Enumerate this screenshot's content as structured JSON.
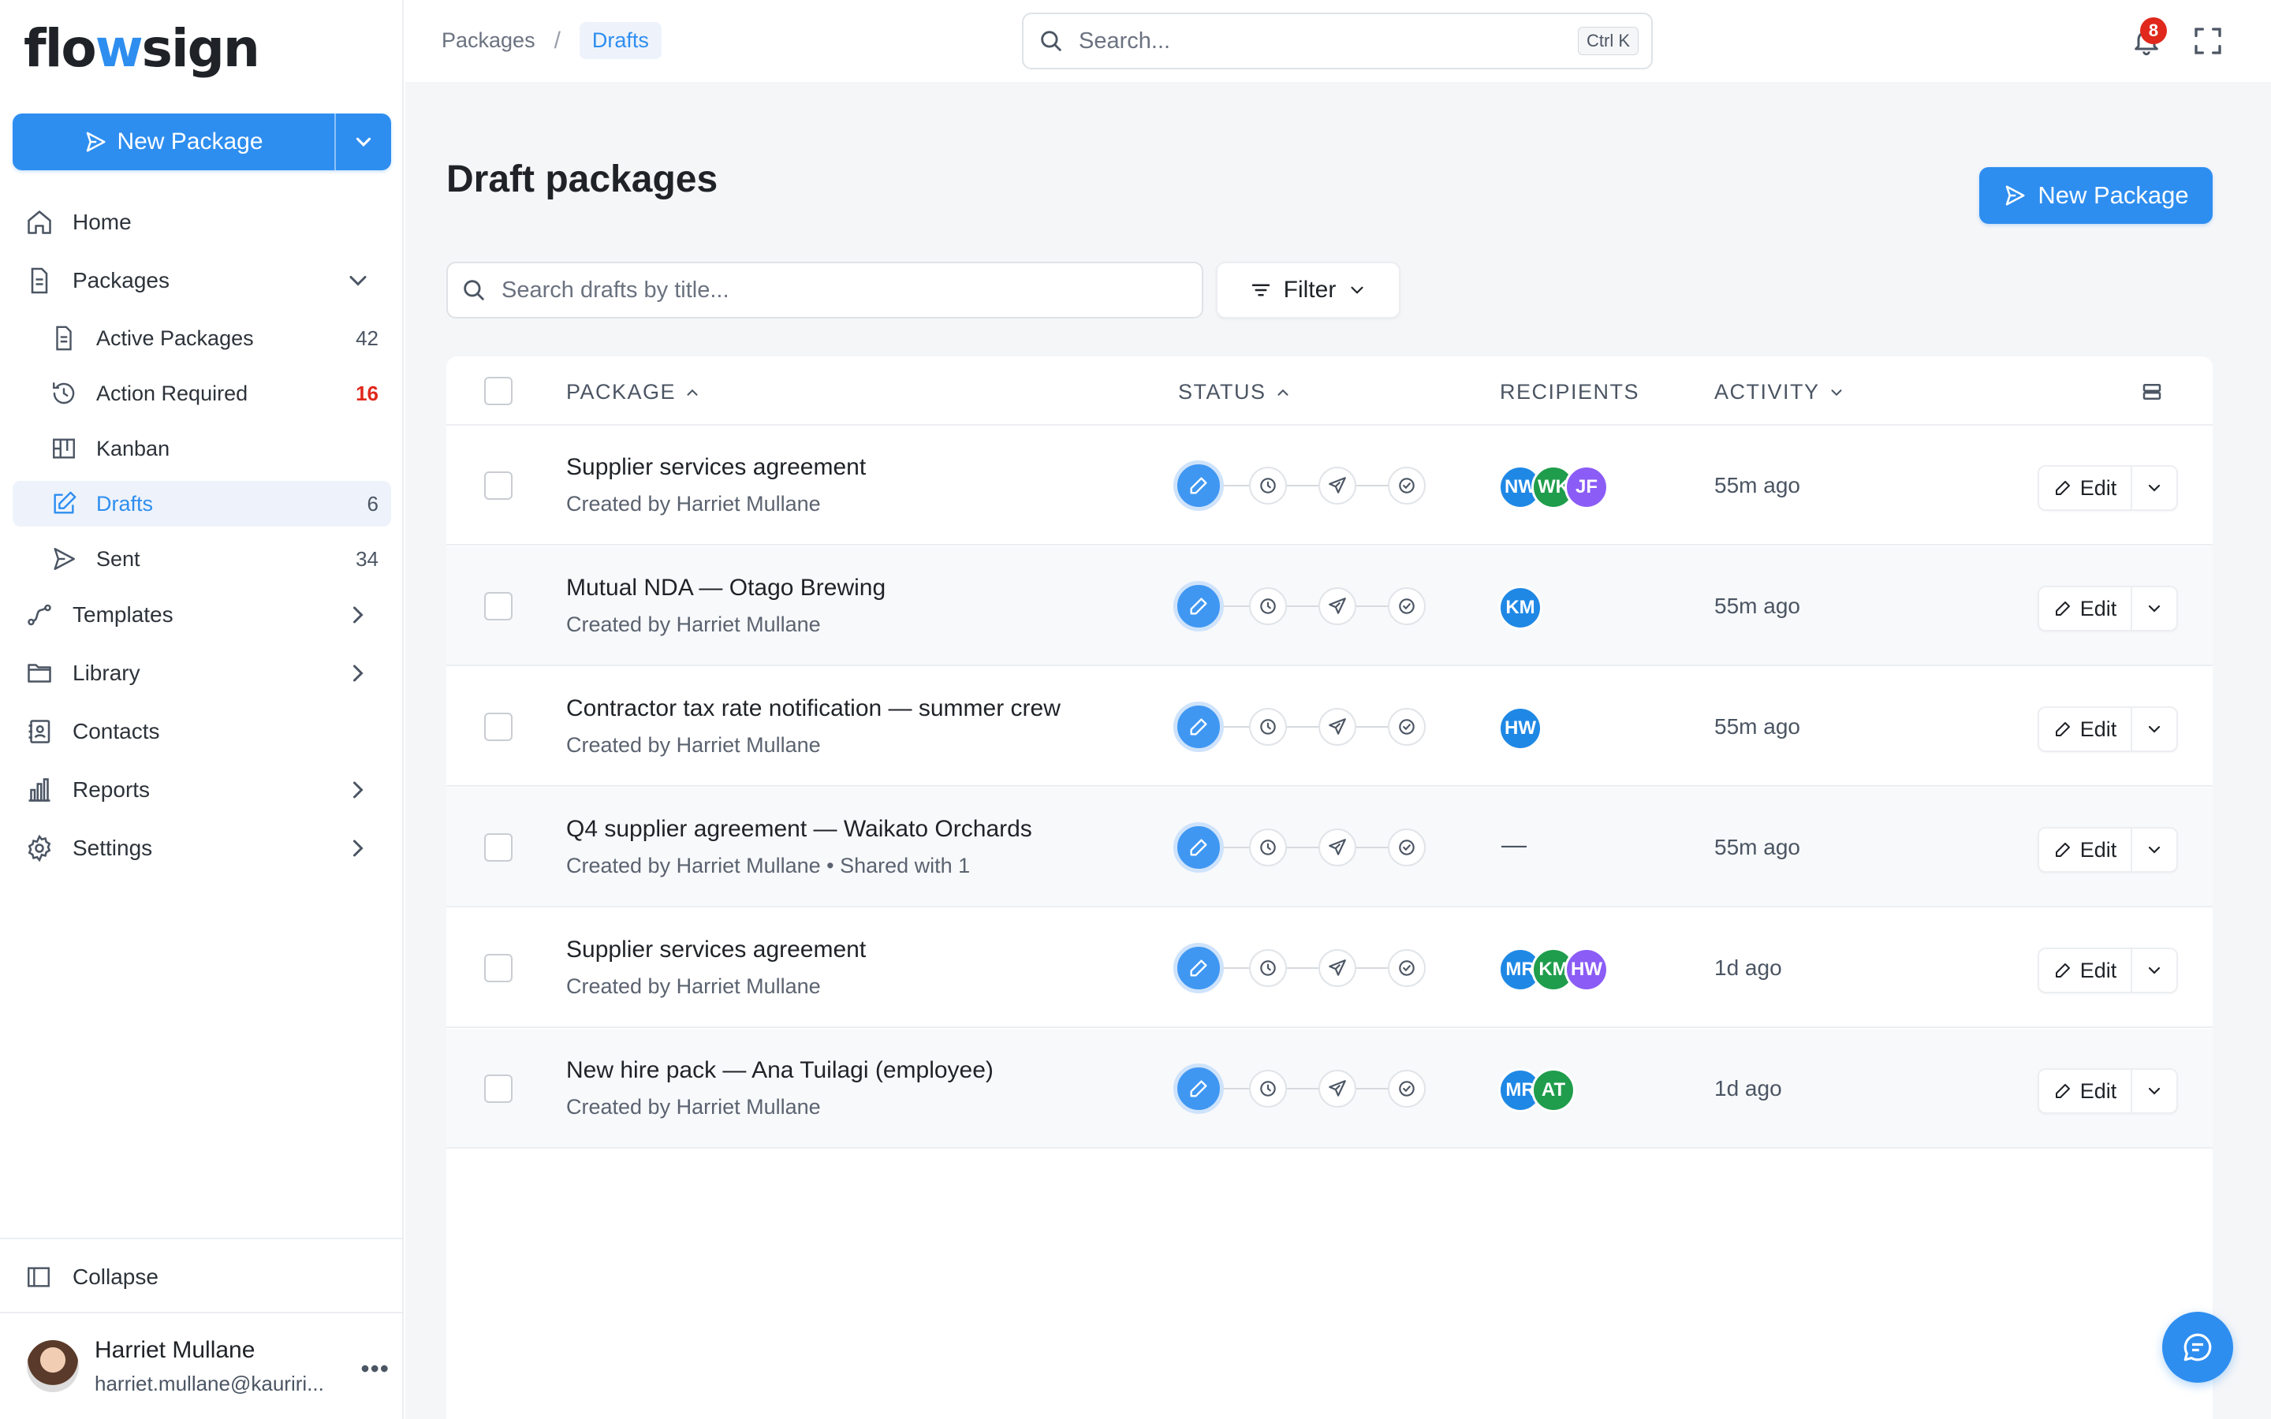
{
  "app": {
    "logo_prefix": "flo",
    "logo_w": "w",
    "logo_suffix": "sign"
  },
  "sidebar": {
    "new_package_label": "New Package",
    "nav": [
      {
        "label": "Home",
        "icon": "home-icon"
      },
      {
        "label": "Packages",
        "icon": "document-icon"
      },
      {
        "label": "Templates",
        "icon": "route-icon"
      },
      {
        "label": "Library",
        "icon": "folder-icon"
      },
      {
        "label": "Contacts",
        "icon": "contact-book-icon"
      },
      {
        "label": "Reports",
        "icon": "bar-chart-icon"
      },
      {
        "label": "Settings",
        "icon": "gear-icon"
      }
    ],
    "packages_sub": [
      {
        "label": "Active Packages",
        "count": "42",
        "icon": "document-icon"
      },
      {
        "label": "Action Required",
        "count": "16",
        "icon": "history-icon"
      },
      {
        "label": "Kanban",
        "count": "",
        "icon": "kanban-icon"
      },
      {
        "label": "Drafts",
        "count": "6",
        "icon": "edit-square-icon"
      },
      {
        "label": "Sent",
        "count": "34",
        "icon": "send-icon"
      }
    ],
    "collapse_label": "Collapse",
    "user": {
      "name": "Harriet Mullane",
      "email": "harriet.mullane@kauriri..."
    }
  },
  "topbar": {
    "breadcrumb": [
      "Packages",
      "Drafts"
    ],
    "search_placeholder": "Search...",
    "search_shortcut": "Ctrl K",
    "notifications_count": "8"
  },
  "main": {
    "title": "Draft packages",
    "new_package_label": "New Package",
    "search_placeholder": "Search drafts by title...",
    "filter_label": "Filter",
    "columns": {
      "package": "PACKAGE",
      "status": "STATUS",
      "recipients": "RECIPIENTS",
      "activity": "ACTIVITY"
    },
    "edit_label": "Edit",
    "rows": [
      {
        "title": "Supplier services agreement",
        "sub": "Created by Harriet Mullane",
        "recipients": [
          "NW",
          "WK",
          "JF"
        ],
        "activity": "55m ago"
      },
      {
        "title": "Mutual NDA — Otago Brewing",
        "sub": "Created by Harriet Mullane",
        "recipients": [
          "KM"
        ],
        "activity": "55m ago"
      },
      {
        "title": "Contractor tax rate notification — summer crew",
        "sub": "Created by Harriet Mullane",
        "recipients": [
          "HW"
        ],
        "activity": "55m ago"
      },
      {
        "title": "Q4 supplier agreement — Waikato Orchards",
        "sub": "Created by Harriet Mullane • Shared with 1",
        "recipients": [],
        "empty_recipients": "—",
        "activity": "55m ago"
      },
      {
        "title": "Supplier services agreement",
        "sub": "Created by Harriet Mullane",
        "recipients": [
          "MR",
          "KM",
          "HW"
        ],
        "activity": "1d ago"
      },
      {
        "title": "New hire pack — Ana Tuilagi (employee)",
        "sub": "Created by Harriet Mullane",
        "recipients": [
          "MR",
          "AT"
        ],
        "activity": "1d ago"
      }
    ]
  },
  "colors": {
    "accent": "#2e8ef0",
    "alert": "#e0281c",
    "avatar_blue": "#1f88e5",
    "avatar_green": "#1f9d4c",
    "avatar_purple": "#8b5cf6"
  }
}
